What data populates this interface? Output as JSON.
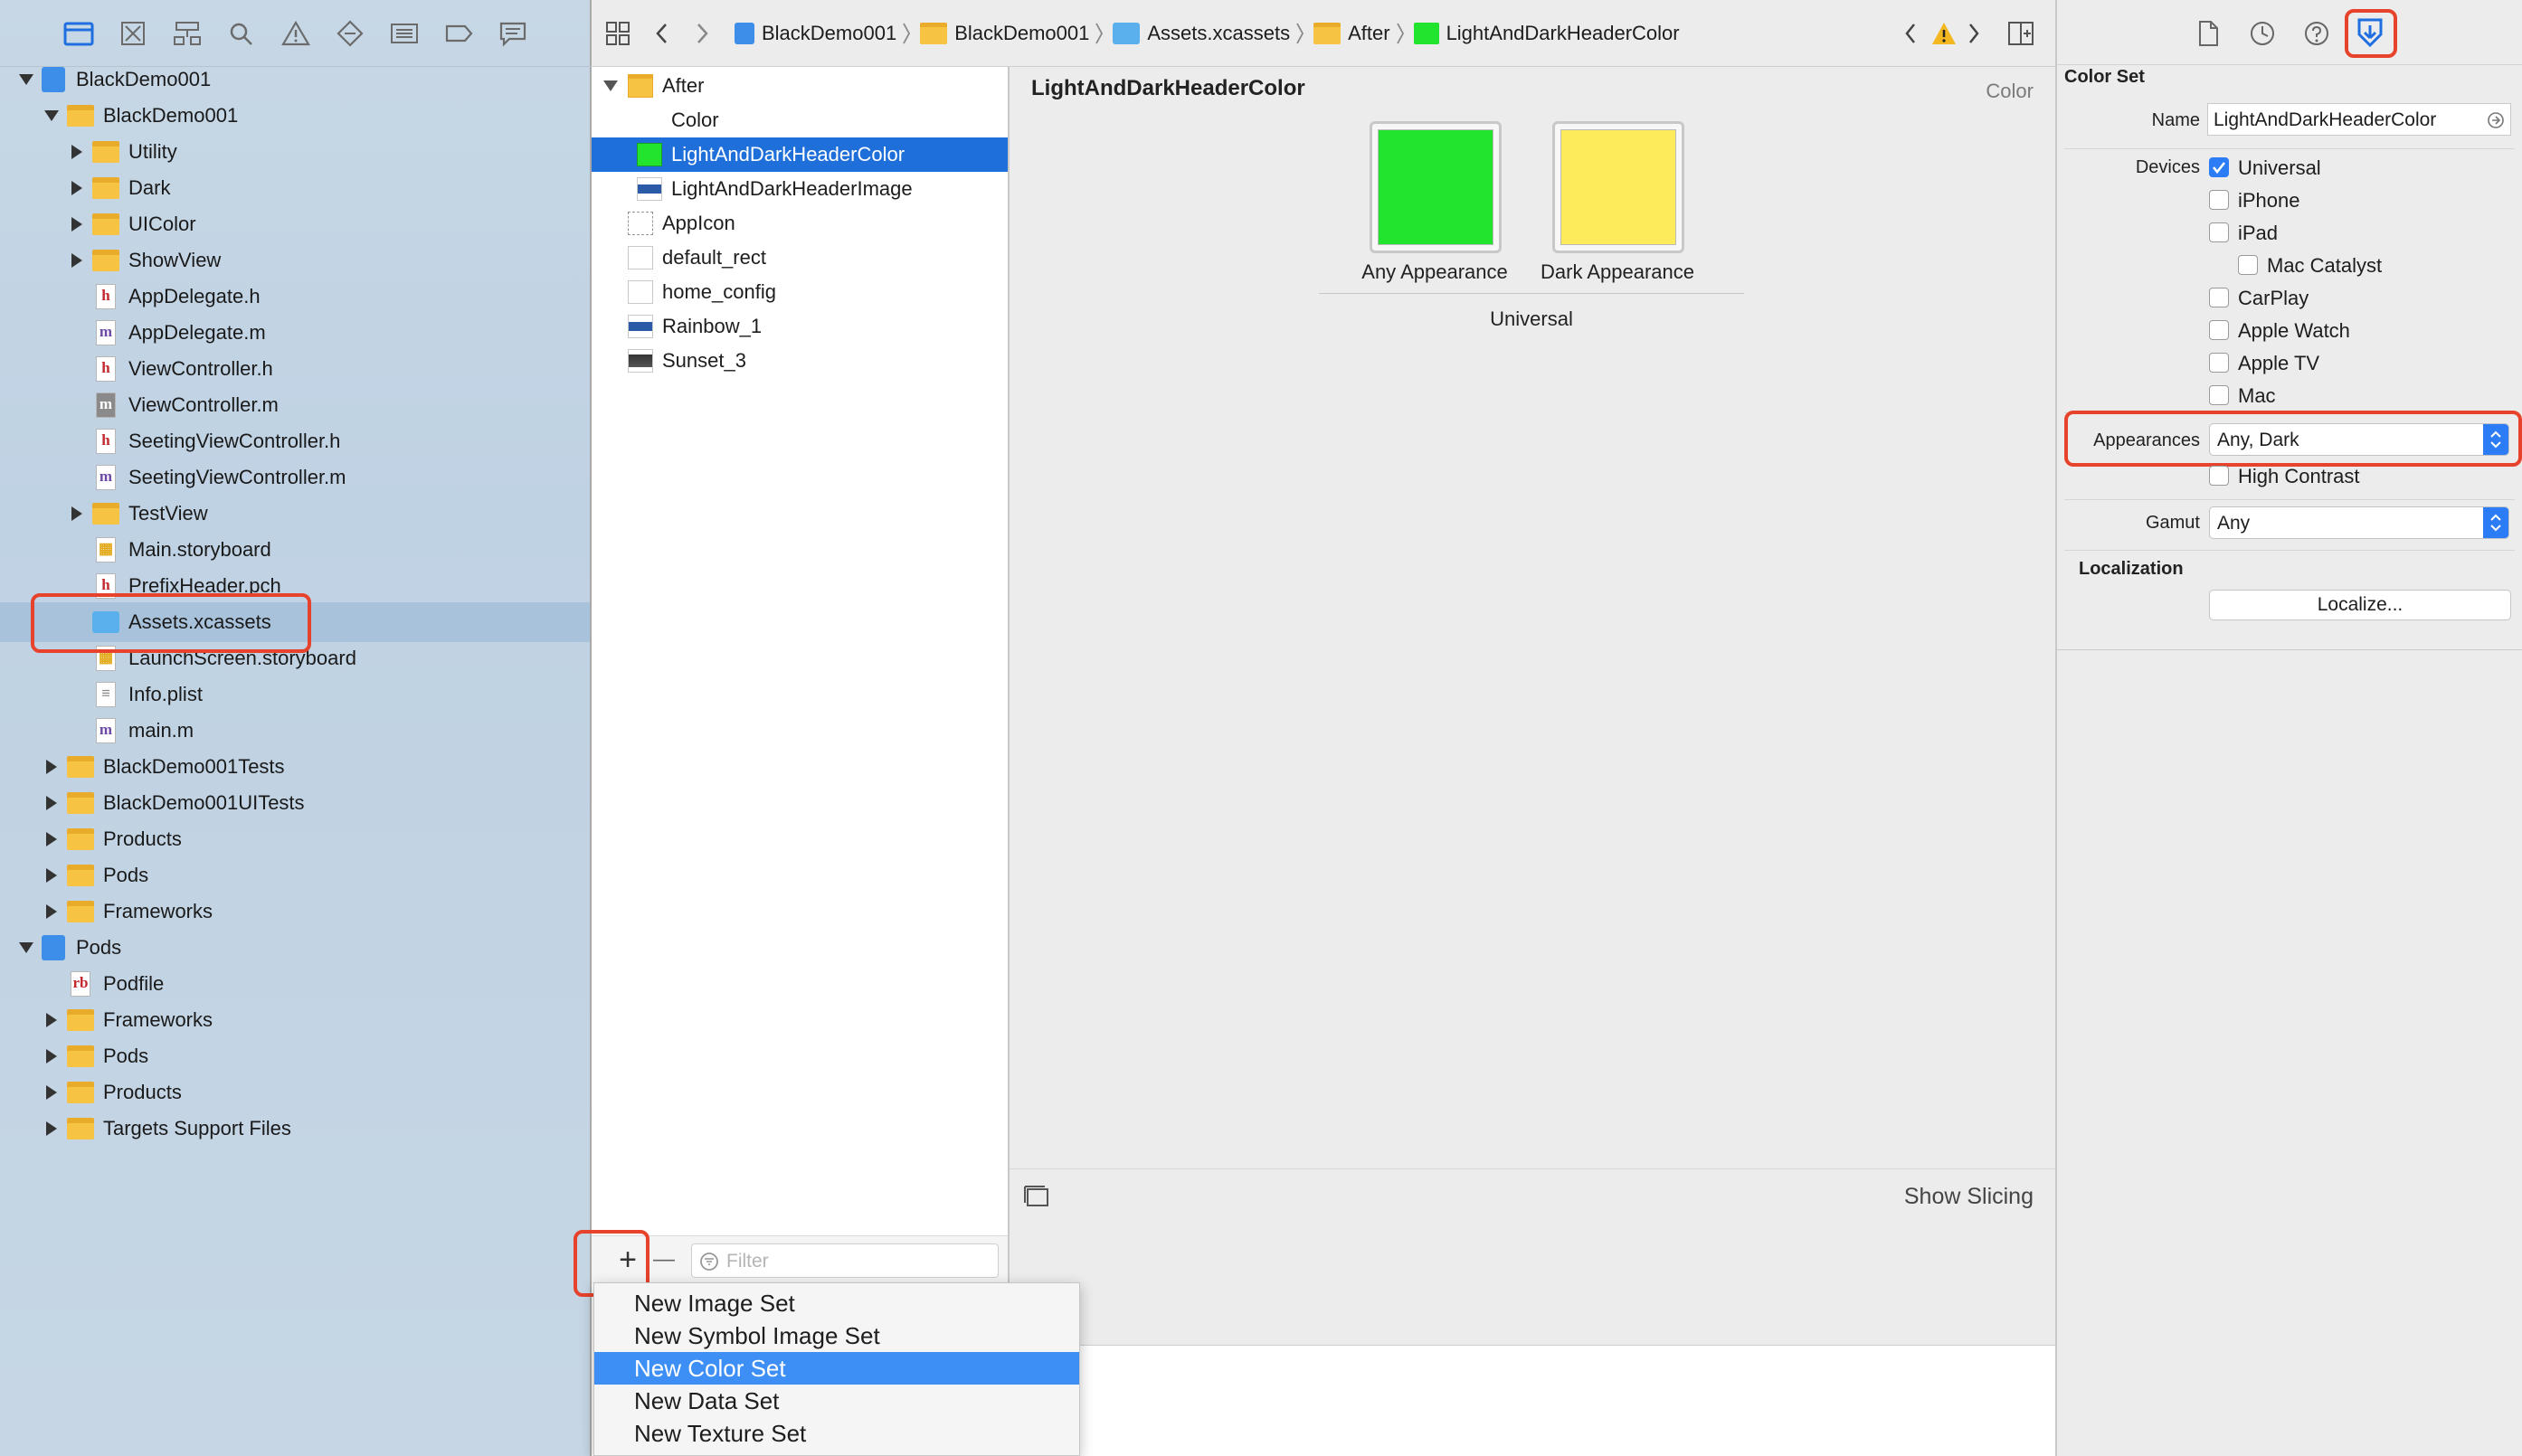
{
  "navigator": {
    "toolbar_icons": [
      "folder-icon",
      "source-control-icon",
      "hierarchy-icon",
      "find-icon",
      "issue-icon",
      "test-icon",
      "debug-icon",
      "breakpoint-icon",
      "report-icon"
    ],
    "tree": [
      {
        "label": "BlackDemo001",
        "level": 0,
        "expanded": true,
        "icon": "project"
      },
      {
        "label": "BlackDemo001",
        "level": 1,
        "expanded": true,
        "icon": "folder"
      },
      {
        "label": "Utility",
        "level": 2,
        "expanded": false,
        "icon": "folder"
      },
      {
        "label": "Dark",
        "level": 2,
        "expanded": false,
        "icon": "folder"
      },
      {
        "label": "UIColor",
        "level": 2,
        "expanded": false,
        "icon": "folder"
      },
      {
        "label": "ShowView",
        "level": 2,
        "expanded": false,
        "icon": "folder"
      },
      {
        "label": "AppDelegate.h",
        "level": 2,
        "icon": "h"
      },
      {
        "label": "AppDelegate.m",
        "level": 2,
        "icon": "m"
      },
      {
        "label": "ViewController.h",
        "level": 2,
        "icon": "h"
      },
      {
        "label": "ViewController.m",
        "level": 2,
        "icon": "m"
      },
      {
        "label": "SeetingViewController.h",
        "level": 2,
        "icon": "h"
      },
      {
        "label": "SeetingViewController.m",
        "level": 2,
        "icon": "m"
      },
      {
        "label": "TestView",
        "level": 2,
        "expanded": false,
        "icon": "folder"
      },
      {
        "label": "Main.storyboard",
        "level": 2,
        "icon": "storyboard"
      },
      {
        "label": "PrefixHeader.pch",
        "level": 2,
        "icon": "h"
      },
      {
        "label": "Assets.xcassets",
        "level": 2,
        "icon": "assets",
        "selected": true
      },
      {
        "label": "LaunchScreen.storyboard",
        "level": 2,
        "icon": "storyboard"
      },
      {
        "label": "Info.plist",
        "level": 2,
        "icon": "plist"
      },
      {
        "label": "main.m",
        "level": 2,
        "icon": "m"
      },
      {
        "label": "BlackDemo001Tests",
        "level": 1,
        "expanded": false,
        "icon": "folder"
      },
      {
        "label": "BlackDemo001UITests",
        "level": 1,
        "expanded": false,
        "icon": "folder"
      },
      {
        "label": "Products",
        "level": 1,
        "expanded": false,
        "icon": "folder"
      },
      {
        "label": "Pods",
        "level": 1,
        "expanded": false,
        "icon": "folder"
      },
      {
        "label": "Frameworks",
        "level": 1,
        "expanded": false,
        "icon": "folder"
      },
      {
        "label": "Pods",
        "level": 0,
        "expanded": true,
        "icon": "project"
      },
      {
        "label": "Podfile",
        "level": 1,
        "icon": "rb"
      },
      {
        "label": "Frameworks",
        "level": 1,
        "expanded": false,
        "icon": "folder"
      },
      {
        "label": "Pods",
        "level": 1,
        "expanded": false,
        "icon": "folder"
      },
      {
        "label": "Products",
        "level": 1,
        "expanded": false,
        "icon": "folder"
      },
      {
        "label": "Targets Support Files",
        "level": 1,
        "expanded": false,
        "icon": "folder"
      }
    ]
  },
  "breadcrumb": {
    "items": [
      "BlackDemo001",
      "BlackDemo001",
      "Assets.xcassets",
      "After",
      "LightAndDarkHeaderColor"
    ]
  },
  "assets": {
    "items": [
      {
        "label": "After",
        "level": 0,
        "expanded": true,
        "icon": "folder"
      },
      {
        "label": "Color",
        "level": 1,
        "icon": "blank"
      },
      {
        "label": "LightAndDarkHeaderColor",
        "level": 1,
        "icon": "green",
        "selected": true
      },
      {
        "label": "LightAndDarkHeaderImage",
        "level": 1,
        "icon": "image"
      },
      {
        "label": "AppIcon",
        "level": 0,
        "icon": "dashed"
      },
      {
        "label": "default_rect",
        "level": 0,
        "icon": "blank"
      },
      {
        "label": "home_config",
        "level": 0,
        "icon": "blank"
      },
      {
        "label": "Rainbow_1",
        "level": 0,
        "icon": "image"
      },
      {
        "label": "Sunset_3",
        "level": 0,
        "icon": "photo"
      }
    ],
    "add_button": "+",
    "remove_button": "—",
    "filter_placeholder": "Filter"
  },
  "editor": {
    "title": "LightAndDarkHeaderColor",
    "type_label": "Color",
    "swatches": [
      {
        "label": "Any Appearance",
        "color": "#22e32e"
      },
      {
        "label": "Dark Appearance",
        "color": "#fdeb5b"
      }
    ],
    "group_label": "Universal",
    "show_slicing": "Show Slicing"
  },
  "context_menu": {
    "items": [
      "New Image Set",
      "New Symbol Image Set",
      "New Color Set",
      "New Data Set",
      "New Texture Set"
    ],
    "selected_index": 2
  },
  "inspector": {
    "section_title": "Color Set",
    "name_label": "Name",
    "name_value": "LightAndDarkHeaderColor",
    "devices_label": "Devices",
    "devices": [
      {
        "label": "Universal",
        "checked": true,
        "indent": 0
      },
      {
        "label": "iPhone",
        "checked": false,
        "indent": 0
      },
      {
        "label": "iPad",
        "checked": false,
        "indent": 0
      },
      {
        "label": "Mac Catalyst",
        "checked": false,
        "indent": 1
      },
      {
        "label": "CarPlay",
        "checked": false,
        "indent": 0
      },
      {
        "label": "Apple Watch",
        "checked": false,
        "indent": 0
      },
      {
        "label": "Apple TV",
        "checked": false,
        "indent": 0
      },
      {
        "label": "Mac",
        "checked": false,
        "indent": 0
      }
    ],
    "appearances_label": "Appearances",
    "appearances_value": "Any, Dark",
    "high_contrast": "High Contrast",
    "gamut_label": "Gamut",
    "gamut_value": "Any",
    "localization_title": "Localization",
    "localize_button": "Localize..."
  },
  "colors": {
    "accent": "#3d8ff6",
    "highlight": "#e7422b",
    "selection": "#1e6fd9"
  }
}
